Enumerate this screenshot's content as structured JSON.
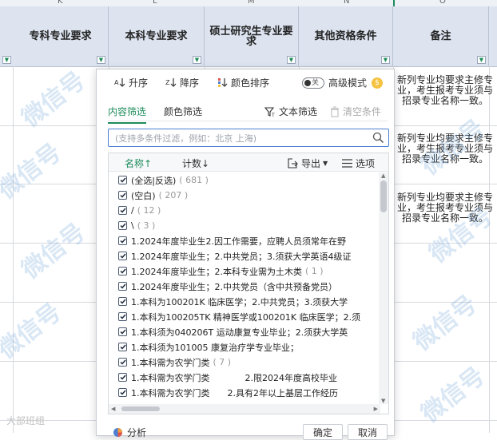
{
  "sheet": {
    "column_letters": [
      "K",
      "L",
      "M",
      "N",
      "O"
    ],
    "headers": [
      "专科专业要求",
      "本科专业要求",
      "硕士研究生专业要求",
      "其他资格条件",
      "备注"
    ],
    "note_text": "新列专业均要求主修专业，考生报考专业须与招录专业名称一致。",
    "watermark": "微信号",
    "footer_mark": "大部班组"
  },
  "popup": {
    "sort_asc": "升序",
    "sort_desc": "降序",
    "sort_color": "颜色排序",
    "toggle_state": "关",
    "advanced_mode": "高级模式",
    "tab_content": "内容筛选",
    "tab_color": "颜色筛选",
    "text_filter": "文本筛选",
    "clear_condition": "清空条件",
    "search_placeholder": "(支持多条件过滤，例如：北京 上海)",
    "col_name": "名称↑",
    "col_count": "计数↓",
    "export": "导出",
    "options": "选项",
    "items": [
      {
        "label": "(全选|反选)",
        "count": "( 681 )"
      },
      {
        "label": "(空白)",
        "count": "( 207 )"
      },
      {
        "label": "/",
        "count": "( 12 )"
      },
      {
        "label": "\\",
        "count": "( 3 )"
      },
      {
        "label": "1.2024年度毕业生2.因工作需要，应聘人员须常年在野",
        "count": ""
      },
      {
        "label": "1.2024年度毕业生；2.中共党员；3.须获大学英语4级证",
        "count": ""
      },
      {
        "label": "1.2024年度毕业生；2.本科专业需为土木类",
        "count": "( 1 )"
      },
      {
        "label": "1.2024年度毕业生；2.中共党员（含中共预备党员）",
        "count": ""
      },
      {
        "label": "1.本科为100201K 临床医学；2.中共党员；3.须获大学",
        "count": ""
      },
      {
        "label": "1.本科为100205TK 精神医学或100201K 临床医学；2.须",
        "count": ""
      },
      {
        "label": "1.本科须为040206T 运动康复专业毕业；2.须获大学英",
        "count": ""
      },
      {
        "label": "1.本科须为101005 康复治疗学专业毕业；",
        "count": ""
      },
      {
        "label": "1.本科需为农学门类",
        "count": "( 7 )"
      },
      {
        "label": "1.本科需为农学门类　　　　2.限2024年度高校毕业",
        "count": ""
      },
      {
        "label": "1.本科需为农学门类　　2.具有2年以上基层工作经历",
        "count": ""
      }
    ],
    "analysis": "分析",
    "ok": "确定",
    "cancel": "取消"
  },
  "colors": {
    "accent_green": "#1d8c5b",
    "header_bg": "#dde4f0",
    "search_border": "#4a7fd4"
  }
}
